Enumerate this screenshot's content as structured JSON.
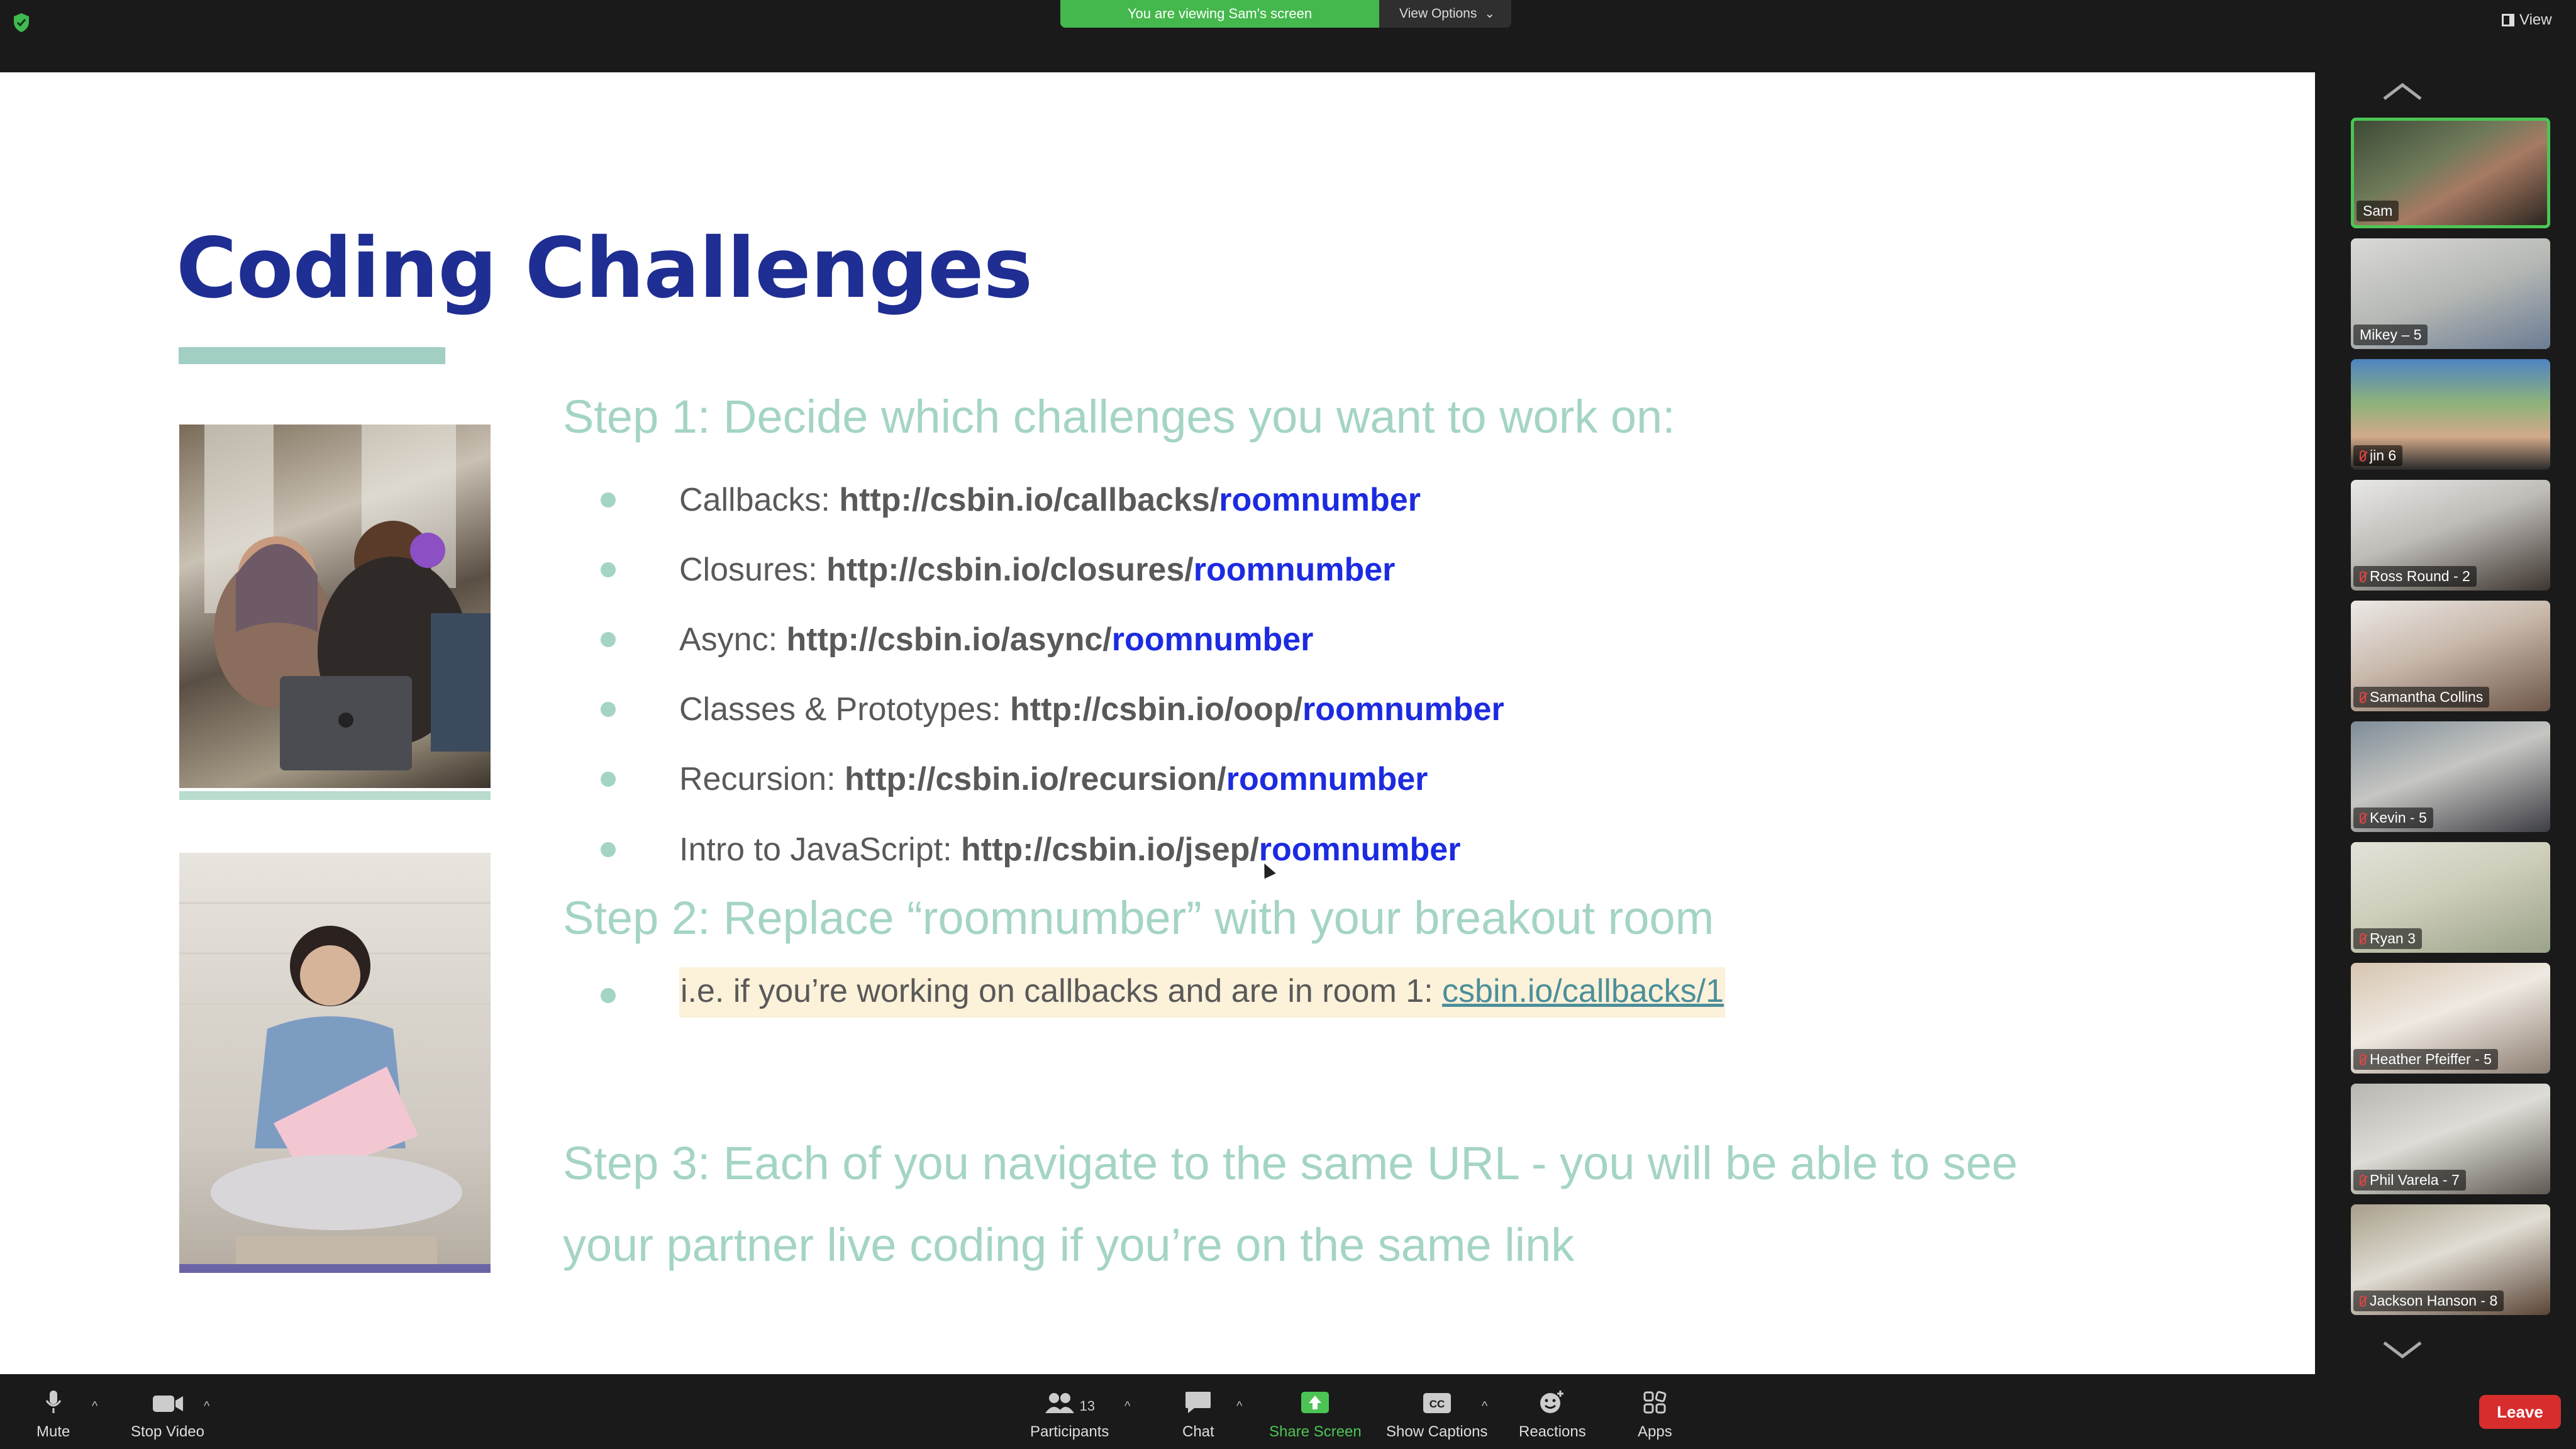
{
  "top_bar": {
    "viewing_label": "You are viewing Sam's screen",
    "view_options_label": "View Options",
    "view_label": "View"
  },
  "slide": {
    "title": "Coding Challenges",
    "step1": "Step 1: Decide which challenges you want to work on:",
    "challenges": [
      {
        "name": "Callbacks:",
        "url": "http://csbin.io/callbacks/",
        "room": "roomnumber"
      },
      {
        "name": "Closures:",
        "url": "http://csbin.io/closures/",
        "room": "roomnumber"
      },
      {
        "name": "Async:",
        "url": "http://csbin.io/async/",
        "room": "roomnumber"
      },
      {
        "name": "Classes & Prototypes:",
        "url": "http://csbin.io/oop/",
        "room": "roomnumber"
      },
      {
        "name": "Recursion:",
        "url": "http://csbin.io/recursion/",
        "room": "roomnumber"
      },
      {
        "name": "Intro to JavaScript:",
        "url": "http://csbin.io/jsep/",
        "room": "roomnumber"
      }
    ],
    "step2": "Step 2: Replace “roomnumber” with your breakout room",
    "example_text": "i.e. if you’re working on callbacks and are in room 1: ",
    "example_link": "csbin.io/callbacks/1",
    "step3_line1": "Step 3: Each of you navigate to the same URL - you will be able to see",
    "step3_line2": "your partner live coding if you’re on the same link"
  },
  "participants": [
    {
      "name": "Sam",
      "muted": false,
      "active": true
    },
    {
      "name": "Mikey – 5",
      "muted": false
    },
    {
      "name": "jin 6",
      "muted": true
    },
    {
      "name": "Ross Round - 2",
      "muted": true
    },
    {
      "name": "Samantha Collins",
      "muted": true
    },
    {
      "name": "Kevin - 5",
      "muted": true
    },
    {
      "name": "Ryan 3",
      "muted": true
    },
    {
      "name": "Heather Pfeiffer - 5",
      "muted": true
    },
    {
      "name": "Phil Varela - 7",
      "muted": true
    },
    {
      "name": "Jackson Hanson - 8",
      "muted": true
    }
  ],
  "toolbar": {
    "mute": "Mute",
    "stop_video": "Stop Video",
    "participants": "Participants",
    "participants_count": "13",
    "chat": "Chat",
    "share_screen": "Share Screen",
    "show_captions": "Show Captions",
    "reactions": "Reactions",
    "apps": "Apps",
    "leave": "Leave"
  },
  "colors": {
    "title": "#1f2e92",
    "step_heading": "#a4d4c5",
    "room_link": "#1c2be0",
    "share_green": "#44b84c",
    "leave_red": "#d72d2d"
  }
}
